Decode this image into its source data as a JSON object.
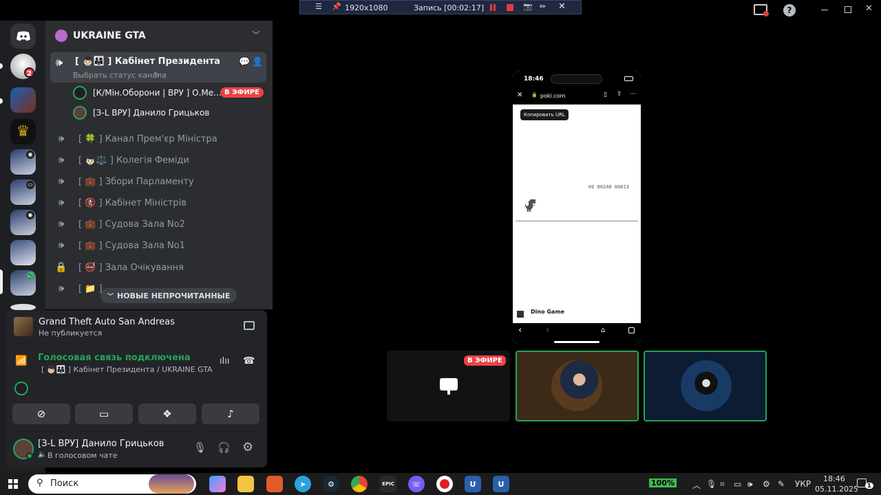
{
  "recording_bar": {
    "resolution": "1920x1080",
    "status": "Запись [00:02:17]"
  },
  "server": {
    "name": "UKRAINE GTA"
  },
  "rail": {
    "badge_count": "2"
  },
  "channels": {
    "active": {
      "name": "[ 👦🏻👨‍👩‍👧 ] Кабінет Президента",
      "status_hint": "Выбрать статус канала"
    },
    "members": [
      {
        "name": "[К/Мін.Оборони | ВРУ ] О.Ме...",
        "live": "В ЭФИРЕ"
      },
      {
        "name": "[З-L ВРУ] Данило Грицьков"
      }
    ],
    "list": [
      {
        "icon": "🍀",
        "label": "Канал Прем'єр Міністра"
      },
      {
        "icon": "👦🏻⚖️",
        "label": "Колегія Феміди"
      },
      {
        "icon": "💼",
        "label": "Збори Парламенту"
      },
      {
        "icon": "🚷",
        "label": "Кабінет Міністрів"
      },
      {
        "icon": "💼",
        "label": "Судова Зала No2"
      },
      {
        "icon": "💼",
        "label": "Судова Зала No1"
      },
      {
        "icon": "🚭",
        "label": "Зала Очікування"
      }
    ],
    "new_unread": "НОВЫЕ НЕПРОЧИТАННЫЕ"
  },
  "activity": {
    "game": "Grand Theft Auto San Andreas",
    "status": "Не публикуется"
  },
  "voice": {
    "state": "Голосовая связь подключена",
    "channel": "[ 👦🏻👨‍👩‍👧 ] Кабінет Президента / UKRAINE GTA"
  },
  "user": {
    "name": "[З-L ВРУ] Данило Грицьков",
    "status": "В голосовом чате"
  },
  "stream": {
    "phone_time": "18:46",
    "url": "poki.com",
    "tooltip": "Копировать URL",
    "hi_score": "HI 00240 00013",
    "game_title": "Dino Game",
    "live_badge": "В ЭФИРЕ"
  },
  "taskbar": {
    "search_label": "Поиск",
    "battery": "100%",
    "lang": "УКР",
    "time": "18:46",
    "date": "05.11.2025",
    "notifications": "1"
  },
  "colors": {
    "accent_green": "#23a55a",
    "live_red": "#ed4245",
    "blurple": "#5865f2"
  }
}
